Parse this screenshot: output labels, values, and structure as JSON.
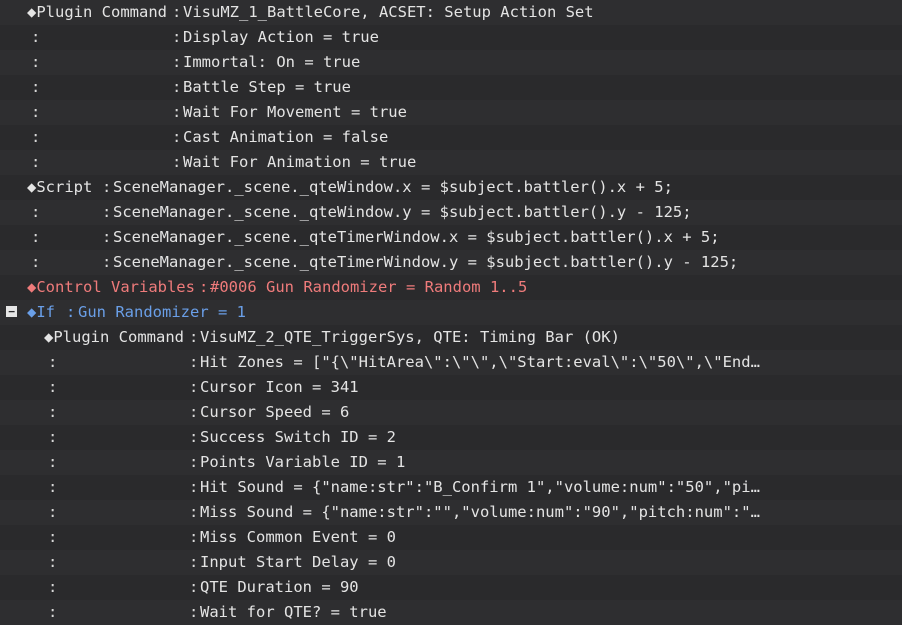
{
  "colors": {
    "background": "#2c2c2e",
    "text": "#e4e4e4",
    "control_variables": "#ef7b7b",
    "conditional": "#6a9fe8"
  },
  "rows": [
    {
      "label": "◆Plugin Command",
      "text": "VisuMZ_1_BattleCore, ACSET: Setup Action Set"
    },
    {
      "label": ":",
      "text": "Display Action = true"
    },
    {
      "label": ":",
      "text": "Immortal: On = true"
    },
    {
      "label": ":",
      "text": "Battle Step = true"
    },
    {
      "label": ":",
      "text": "Wait For Movement = true"
    },
    {
      "label": ":",
      "text": "Cast Animation = false"
    },
    {
      "label": ":",
      "text": "Wait For Animation = true"
    },
    {
      "label": "◆Script",
      "text": "SceneManager._scene._qteWindow.x = $subject.battler().x + 5;"
    },
    {
      "label": ":",
      "text": "SceneManager._scene._qteWindow.y = $subject.battler().y - 125;"
    },
    {
      "label": ":",
      "text": "SceneManager._scene._qteTimerWindow.x = $subject.battler().x + 5;"
    },
    {
      "label": ":",
      "text": "SceneManager._scene._qteTimerWindow.y = $subject.battler().y - 125;"
    },
    {
      "label": "◆Control Variables",
      "text": "#0006 Gun Randomizer = Random 1..5"
    },
    {
      "fold": "−",
      "label": "◆If",
      "text": "Gun Randomizer = 1"
    },
    {
      "label": "◆Plugin Command",
      "text": "VisuMZ_2_QTE_TriggerSys, QTE: Timing Bar (OK)"
    },
    {
      "label": ":",
      "text": "Hit Zones = [\"{\\\"HitArea\\\":\\\"\\\",\\\"Start:eval\\\":\\\"50\\\",\\\"End…"
    },
    {
      "label": ":",
      "text": "Cursor Icon = 341"
    },
    {
      "label": ":",
      "text": "Cursor Speed = 6"
    },
    {
      "label": ":",
      "text": "Success Switch ID = 2"
    },
    {
      "label": ":",
      "text": "Points Variable ID = 1"
    },
    {
      "label": ":",
      "text": "Hit Sound = {\"name:str\":\"B_Confirm 1\",\"volume:num\":\"50\",\"pi…"
    },
    {
      "label": ":",
      "text": "Miss Sound = {\"name:str\":\"\",\"volume:num\":\"90\",\"pitch:num\":\"…"
    },
    {
      "label": ":",
      "text": "Miss Common Event = 0"
    },
    {
      "label": ":",
      "text": "Input Start Delay = 0"
    },
    {
      "label": ":",
      "text": "QTE Duration = 90"
    },
    {
      "label": ":",
      "text": "Wait for QTE? = true"
    }
  ]
}
